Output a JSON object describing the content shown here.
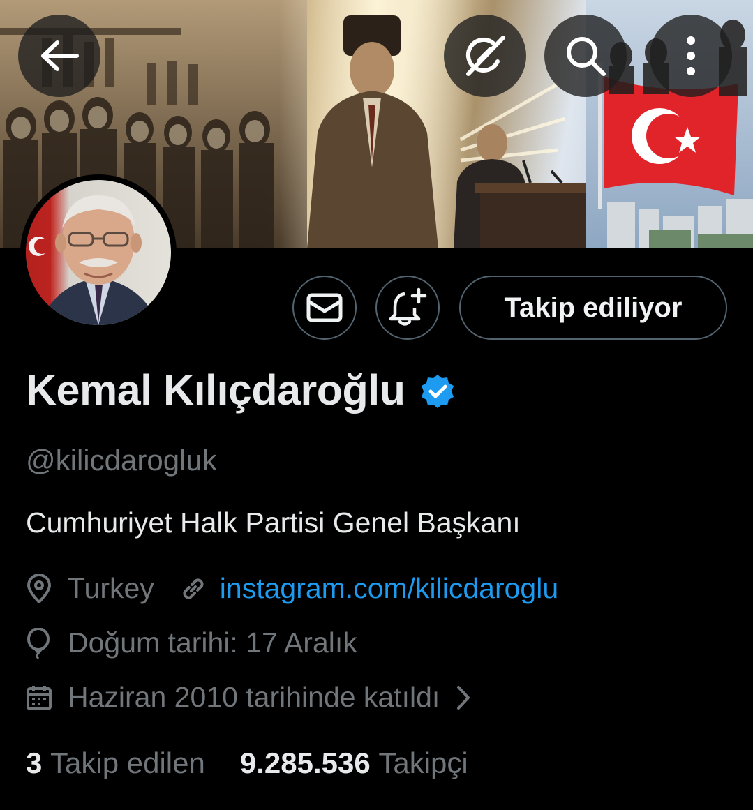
{
  "header": {
    "back_icon": "arrow-left-icon",
    "grok_icon": "grok-icon",
    "search_icon": "search-icon",
    "more_icon": "more-vertical-icon"
  },
  "actions": {
    "message_icon": "envelope-icon",
    "notify_icon": "bell-plus-icon",
    "follow_label": "Takip ediliyor"
  },
  "profile": {
    "display_name": "Kemal Kılıçdaroğlu",
    "verified": true,
    "handle": "@kilicdarogluk",
    "bio": "Cumhuriyet Halk Partisi Genel Başkanı",
    "location": "Turkey",
    "website": "instagram.com/kilicdaroglu",
    "birthday": "Doğum tarihi: 17 Aralık",
    "joined": "Haziran 2010 tarihinde katıldı"
  },
  "stats": {
    "following_count": "3",
    "following_label": "Takip edilen",
    "followers_count": "9.285.536",
    "followers_label": "Takipçi"
  },
  "colors": {
    "background": "#000000",
    "accent_blue": "#1d9bf0",
    "secondary_text": "#71767b",
    "primary_text": "#e7e9ea",
    "border": "#536471"
  }
}
